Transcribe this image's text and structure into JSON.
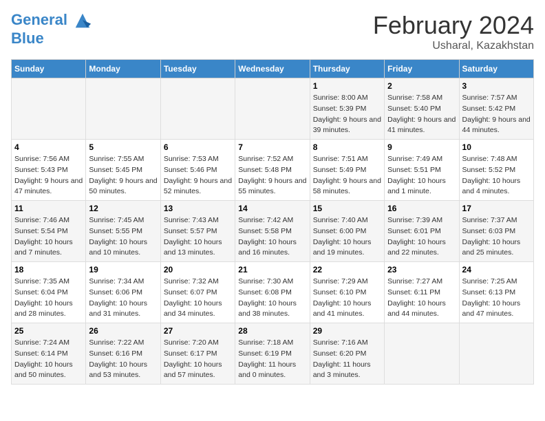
{
  "header": {
    "logo_line1": "General",
    "logo_line2": "Blue",
    "main_title": "February 2024",
    "subtitle": "Usharal, Kazakhstan"
  },
  "days_of_week": [
    "Sunday",
    "Monday",
    "Tuesday",
    "Wednesday",
    "Thursday",
    "Friday",
    "Saturday"
  ],
  "weeks": [
    [
      {
        "day": "",
        "sunrise": "",
        "sunset": "",
        "daylight": ""
      },
      {
        "day": "",
        "sunrise": "",
        "sunset": "",
        "daylight": ""
      },
      {
        "day": "",
        "sunrise": "",
        "sunset": "",
        "daylight": ""
      },
      {
        "day": "",
        "sunrise": "",
        "sunset": "",
        "daylight": ""
      },
      {
        "day": "1",
        "sunrise": "Sunrise: 8:00 AM",
        "sunset": "Sunset: 5:39 PM",
        "daylight": "Daylight: 9 hours and 39 minutes."
      },
      {
        "day": "2",
        "sunrise": "Sunrise: 7:58 AM",
        "sunset": "Sunset: 5:40 PM",
        "daylight": "Daylight: 9 hours and 41 minutes."
      },
      {
        "day": "3",
        "sunrise": "Sunrise: 7:57 AM",
        "sunset": "Sunset: 5:42 PM",
        "daylight": "Daylight: 9 hours and 44 minutes."
      }
    ],
    [
      {
        "day": "4",
        "sunrise": "Sunrise: 7:56 AM",
        "sunset": "Sunset: 5:43 PM",
        "daylight": "Daylight: 9 hours and 47 minutes."
      },
      {
        "day": "5",
        "sunrise": "Sunrise: 7:55 AM",
        "sunset": "Sunset: 5:45 PM",
        "daylight": "Daylight: 9 hours and 50 minutes."
      },
      {
        "day": "6",
        "sunrise": "Sunrise: 7:53 AM",
        "sunset": "Sunset: 5:46 PM",
        "daylight": "Daylight: 9 hours and 52 minutes."
      },
      {
        "day": "7",
        "sunrise": "Sunrise: 7:52 AM",
        "sunset": "Sunset: 5:48 PM",
        "daylight": "Daylight: 9 hours and 55 minutes."
      },
      {
        "day": "8",
        "sunrise": "Sunrise: 7:51 AM",
        "sunset": "Sunset: 5:49 PM",
        "daylight": "Daylight: 9 hours and 58 minutes."
      },
      {
        "day": "9",
        "sunrise": "Sunrise: 7:49 AM",
        "sunset": "Sunset: 5:51 PM",
        "daylight": "Daylight: 10 hours and 1 minute."
      },
      {
        "day": "10",
        "sunrise": "Sunrise: 7:48 AM",
        "sunset": "Sunset: 5:52 PM",
        "daylight": "Daylight: 10 hours and 4 minutes."
      }
    ],
    [
      {
        "day": "11",
        "sunrise": "Sunrise: 7:46 AM",
        "sunset": "Sunset: 5:54 PM",
        "daylight": "Daylight: 10 hours and 7 minutes."
      },
      {
        "day": "12",
        "sunrise": "Sunrise: 7:45 AM",
        "sunset": "Sunset: 5:55 PM",
        "daylight": "Daylight: 10 hours and 10 minutes."
      },
      {
        "day": "13",
        "sunrise": "Sunrise: 7:43 AM",
        "sunset": "Sunset: 5:57 PM",
        "daylight": "Daylight: 10 hours and 13 minutes."
      },
      {
        "day": "14",
        "sunrise": "Sunrise: 7:42 AM",
        "sunset": "Sunset: 5:58 PM",
        "daylight": "Daylight: 10 hours and 16 minutes."
      },
      {
        "day": "15",
        "sunrise": "Sunrise: 7:40 AM",
        "sunset": "Sunset: 6:00 PM",
        "daylight": "Daylight: 10 hours and 19 minutes."
      },
      {
        "day": "16",
        "sunrise": "Sunrise: 7:39 AM",
        "sunset": "Sunset: 6:01 PM",
        "daylight": "Daylight: 10 hours and 22 minutes."
      },
      {
        "day": "17",
        "sunrise": "Sunrise: 7:37 AM",
        "sunset": "Sunset: 6:03 PM",
        "daylight": "Daylight: 10 hours and 25 minutes."
      }
    ],
    [
      {
        "day": "18",
        "sunrise": "Sunrise: 7:35 AM",
        "sunset": "Sunset: 6:04 PM",
        "daylight": "Daylight: 10 hours and 28 minutes."
      },
      {
        "day": "19",
        "sunrise": "Sunrise: 7:34 AM",
        "sunset": "Sunset: 6:06 PM",
        "daylight": "Daylight: 10 hours and 31 minutes."
      },
      {
        "day": "20",
        "sunrise": "Sunrise: 7:32 AM",
        "sunset": "Sunset: 6:07 PM",
        "daylight": "Daylight: 10 hours and 34 minutes."
      },
      {
        "day": "21",
        "sunrise": "Sunrise: 7:30 AM",
        "sunset": "Sunset: 6:08 PM",
        "daylight": "Daylight: 10 hours and 38 minutes."
      },
      {
        "day": "22",
        "sunrise": "Sunrise: 7:29 AM",
        "sunset": "Sunset: 6:10 PM",
        "daylight": "Daylight: 10 hours and 41 minutes."
      },
      {
        "day": "23",
        "sunrise": "Sunrise: 7:27 AM",
        "sunset": "Sunset: 6:11 PM",
        "daylight": "Daylight: 10 hours and 44 minutes."
      },
      {
        "day": "24",
        "sunrise": "Sunrise: 7:25 AM",
        "sunset": "Sunset: 6:13 PM",
        "daylight": "Daylight: 10 hours and 47 minutes."
      }
    ],
    [
      {
        "day": "25",
        "sunrise": "Sunrise: 7:24 AM",
        "sunset": "Sunset: 6:14 PM",
        "daylight": "Daylight: 10 hours and 50 minutes."
      },
      {
        "day": "26",
        "sunrise": "Sunrise: 7:22 AM",
        "sunset": "Sunset: 6:16 PM",
        "daylight": "Daylight: 10 hours and 53 minutes."
      },
      {
        "day": "27",
        "sunrise": "Sunrise: 7:20 AM",
        "sunset": "Sunset: 6:17 PM",
        "daylight": "Daylight: 10 hours and 57 minutes."
      },
      {
        "day": "28",
        "sunrise": "Sunrise: 7:18 AM",
        "sunset": "Sunset: 6:19 PM",
        "daylight": "Daylight: 11 hours and 0 minutes."
      },
      {
        "day": "29",
        "sunrise": "Sunrise: 7:16 AM",
        "sunset": "Sunset: 6:20 PM",
        "daylight": "Daylight: 11 hours and 3 minutes."
      },
      {
        "day": "",
        "sunrise": "",
        "sunset": "",
        "daylight": ""
      },
      {
        "day": "",
        "sunrise": "",
        "sunset": "",
        "daylight": ""
      }
    ]
  ]
}
